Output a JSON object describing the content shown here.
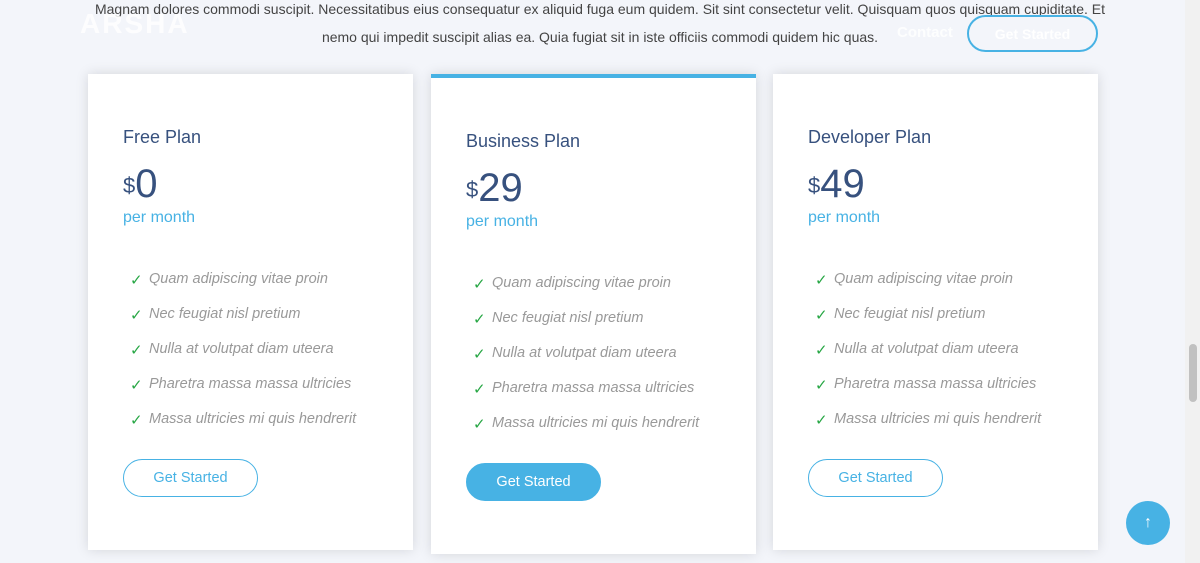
{
  "intro": {
    "line1": "Magnam dolores commodi suscipit. Necessitatibus eius consequatur ex aliquid fuga eum quidem. Sit sint consectetur velit. Quisquam quos quisquam cupiditate. Et",
    "line2": "nemo qui impedit suscipit alias ea. Quia fugiat sit in iste officiis commodi quidem hic quas."
  },
  "header": {
    "logo": "ARSHA",
    "nav_contact": "Contact",
    "cta": "Get Started"
  },
  "plans": [
    {
      "name": "Free Plan",
      "currency": "$",
      "price": "0",
      "period": "per month",
      "features": [
        "Quam adipiscing vitae proin",
        "Nec feugiat nisl pretium",
        "Nulla at volutpat diam uteera",
        "Pharetra massa massa ultricies",
        "Massa ultricies mi quis hendrerit"
      ],
      "button": "Get Started"
    },
    {
      "name": "Business Plan",
      "currency": "$",
      "price": "29",
      "period": "per month",
      "features": [
        "Quam adipiscing vitae proin",
        "Nec feugiat nisl pretium",
        "Nulla at volutpat diam uteera",
        "Pharetra massa massa ultricies",
        "Massa ultricies mi quis hendrerit"
      ],
      "button": "Get Started"
    },
    {
      "name": "Developer Plan",
      "currency": "$",
      "price": "49",
      "period": "per month",
      "features": [
        "Quam adipiscing vitae proin",
        "Nec feugiat nisl pretium",
        "Nulla at volutpat diam uteera",
        "Pharetra massa massa ultricies",
        "Massa ultricies mi quis hendrerit"
      ],
      "button": "Get Started"
    }
  ],
  "icons": {
    "check": "✓",
    "back_to_top": "↑"
  },
  "colors": {
    "accent": "#47b2e4",
    "heading": "#37517e",
    "check": "#28a745",
    "background": "#f3f5fa"
  }
}
